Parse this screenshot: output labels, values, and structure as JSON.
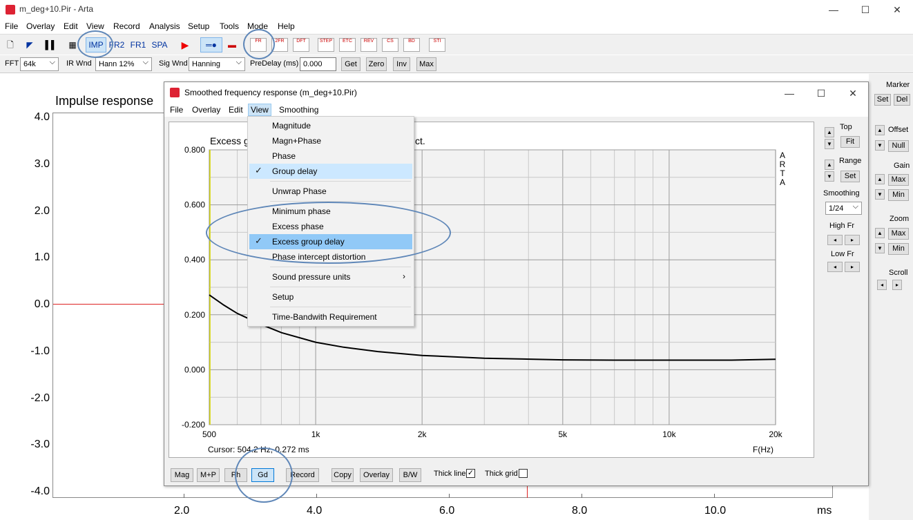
{
  "app": {
    "title": "m_deg+10.Pir - Arta",
    "window_controls": [
      "—",
      "☐",
      "✕"
    ]
  },
  "menubar": [
    "File",
    "Overlay",
    "Edit",
    "View",
    "Record",
    "Analysis",
    "Setup",
    "Tools",
    "Mode",
    "Help"
  ],
  "toolbar1": {
    "mode_buttons": [
      "IMP",
      "FR2",
      "FR1",
      "SPA"
    ],
    "active_mode": "IMP",
    "icon_buttons": [
      "FR",
      "2FR",
      "DFT",
      "STEP",
      "ETC",
      "REV",
      "CS",
      "BD",
      "STI"
    ]
  },
  "toolbar2": {
    "fft_label": "FFT",
    "fft_value": "64k",
    "irwnd_label": "IR Wnd",
    "irwnd_value": "Hann 12%",
    "sigwnd_label": "Sig Wnd",
    "sigwnd_value": "Hanning",
    "predelay_label": "PreDelay (ms)",
    "predelay_value": "0.000",
    "buttons": [
      "Get",
      "Zero",
      "Inv",
      "Max"
    ]
  },
  "main_plot": {
    "title": "Impulse response",
    "y_ticks": [
      "4.0",
      "3.0",
      "2.0",
      "1.0",
      "0.0",
      "-1.0",
      "-2.0",
      "-3.0",
      "-4.0"
    ],
    "x_ticks": [
      "2.0",
      "4.0",
      "6.0",
      "8.0",
      "10.0"
    ],
    "x_unit": "ms"
  },
  "right_panel": {
    "marker_label": "Marker",
    "marker_set": "Set",
    "marker_del": "Del",
    "offset_label": "Offset",
    "offset_null": "Null",
    "gain_label": "Gain",
    "gain_max": "Max",
    "gain_min": "Min",
    "zoom_label": "Zoom",
    "zoom_max": "Max",
    "zoom_min": "Min",
    "scroll_label": "Scroll"
  },
  "child_window": {
    "title": "Smoothed frequency response (m_deg+10.Pir)",
    "menu": [
      "File",
      "Overlay",
      "Edit",
      "View",
      "Smoothing"
    ],
    "open_menu": "View",
    "plot_title_left": "Excess g",
    "plot_title_right": "ct.",
    "arta_vertical": [
      "A",
      "R",
      "T",
      "A"
    ],
    "cursor_text": "Cursor: 504.2 Hz, 0.272 ms",
    "x_unit": "F(Hz)",
    "side": {
      "top_label": "Top",
      "top_fit": "Fit",
      "range_label": "Range",
      "range_set": "Set",
      "smoothing_label": "Smoothing",
      "smoothing_value": "1/24",
      "highfr_label": "High Fr",
      "lowfr_label": "Low Fr"
    },
    "bottom_buttons": [
      "Mag",
      "M+P",
      "Ph",
      "Gd",
      "Record",
      "Copy",
      "Overlay",
      "B/W"
    ],
    "active_bottom": "Gd",
    "thick_line_label": "Thick line",
    "thick_line_checked": true,
    "thick_grid_label": "Thick grid",
    "thick_grid_checked": false
  },
  "view_menu": {
    "items": [
      {
        "label": "Magnitude",
        "checked": false
      },
      {
        "label": "Magn+Phase",
        "checked": false
      },
      {
        "label": "Phase",
        "checked": false
      },
      {
        "label": "Group delay",
        "checked": true
      },
      {
        "label": "Unwrap Phase",
        "checked": false
      },
      {
        "label": "Minimum phase",
        "checked": false
      },
      {
        "label": "Excess phase",
        "checked": false
      },
      {
        "label": "Excess group delay",
        "checked": true,
        "highlighted": true
      },
      {
        "label": "Phase intercept distortion",
        "checked": false
      },
      {
        "label": "Sound pressure units",
        "checked": false,
        "submenu": true
      },
      {
        "label": "Setup",
        "checked": false
      },
      {
        "label": "Time-Bandwith Requirement",
        "checked": false
      }
    ]
  },
  "chart_data": {
    "type": "line",
    "title": "",
    "xlabel": "F(Hz)",
    "ylabel": "",
    "x_scale": "log",
    "xlim": [
      500,
      20000
    ],
    "ylim": [
      -0.2,
      0.8
    ],
    "y_ticks": [
      "0.800",
      "0.600",
      "0.400",
      "0.200",
      "0.000",
      "-0.200"
    ],
    "x_ticks": [
      "500",
      "1k",
      "2k",
      "5k",
      "10k",
      "20k"
    ],
    "grid": true,
    "series": [
      {
        "x": [
          500,
          550,
          600,
          700,
          800,
          1000,
          1200,
          1500,
          2000,
          3000,
          5000,
          7000,
          10000,
          15000,
          20000
        ],
        "y": [
          0.272,
          0.235,
          0.205,
          0.165,
          0.135,
          0.1,
          0.082,
          0.066,
          0.052,
          0.042,
          0.036,
          0.035,
          0.035,
          0.035,
          0.038
        ]
      }
    ]
  }
}
